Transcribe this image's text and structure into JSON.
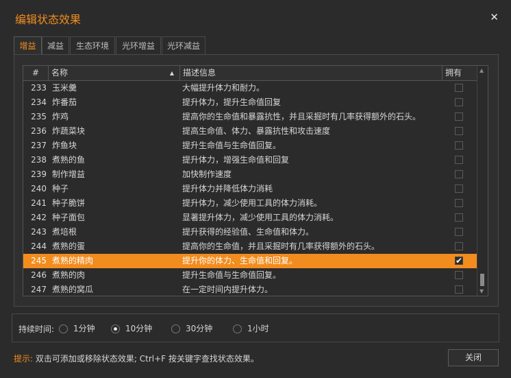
{
  "window": {
    "title": "编辑状态效果",
    "close_glyph": "✕"
  },
  "tabs": [
    "增益",
    "减益",
    "生态环境",
    "光环增益",
    "光环减益"
  ],
  "active_tab": 0,
  "columns": {
    "num": "#",
    "name": "名称",
    "desc": "描述信息",
    "owned": "拥有"
  },
  "rows": [
    {
      "num": "233",
      "name": "玉米羹",
      "desc": "大幅提升体力和耐力。",
      "owned": false
    },
    {
      "num": "234",
      "name": "炸番茄",
      "desc": "提升体力，提升生命值回复",
      "owned": false
    },
    {
      "num": "235",
      "name": "炸鸡",
      "desc": "提高你的生命值和暴露抗性，并且采掘时有几率获得额外的石头。",
      "owned": false
    },
    {
      "num": "236",
      "name": "炸蔬菜块",
      "desc": "提高生命值、体力、暴露抗性和攻击速度",
      "owned": false
    },
    {
      "num": "237",
      "name": "炸鱼块",
      "desc": "提升生命值与生命值回复。",
      "owned": false
    },
    {
      "num": "238",
      "name": "煮熟的鱼",
      "desc": "提升体力，增强生命值和回复",
      "owned": false
    },
    {
      "num": "239",
      "name": "制作增益",
      "desc": "加快制作速度",
      "owned": false
    },
    {
      "num": "240",
      "name": "种子",
      "desc": "提升体力并降低体力消耗",
      "owned": false
    },
    {
      "num": "241",
      "name": "种子脆饼",
      "desc": "提升体力，减少使用工具的体力消耗。",
      "owned": false
    },
    {
      "num": "242",
      "name": "种子面包",
      "desc": "显著提升体力，减少使用工具的体力消耗。",
      "owned": false
    },
    {
      "num": "243",
      "name": "煮培根",
      "desc": "提升获得的经验值、生命值和体力。",
      "owned": false
    },
    {
      "num": "244",
      "name": "煮熟的蛋",
      "desc": "提高你的生命值，并且采掘时有几率获得额外的石头。",
      "owned": false
    },
    {
      "num": "245",
      "name": "煮熟的精肉",
      "desc": "提升你的体力、生命值和回复。",
      "owned": true
    },
    {
      "num": "246",
      "name": "煮熟的肉",
      "desc": "提升生命值与生命值回复。",
      "owned": false
    },
    {
      "num": "247",
      "name": "煮熟的窝瓜",
      "desc": "在一定时间内提升体力。",
      "owned": false
    }
  ],
  "selected_row": 12,
  "duration": {
    "label": "持续时间:",
    "options": [
      "1分钟",
      "10分钟",
      "30分钟",
      "1小时"
    ],
    "selected": 1
  },
  "hint": {
    "label": "提示:",
    "text": "双击可添加或移除状态效果; Ctrl+F 按关键字查找状态效果。"
  },
  "buttons": {
    "close": "关闭"
  },
  "colors": {
    "accent": "#f28c1e",
    "background": "#2b2b2b"
  }
}
